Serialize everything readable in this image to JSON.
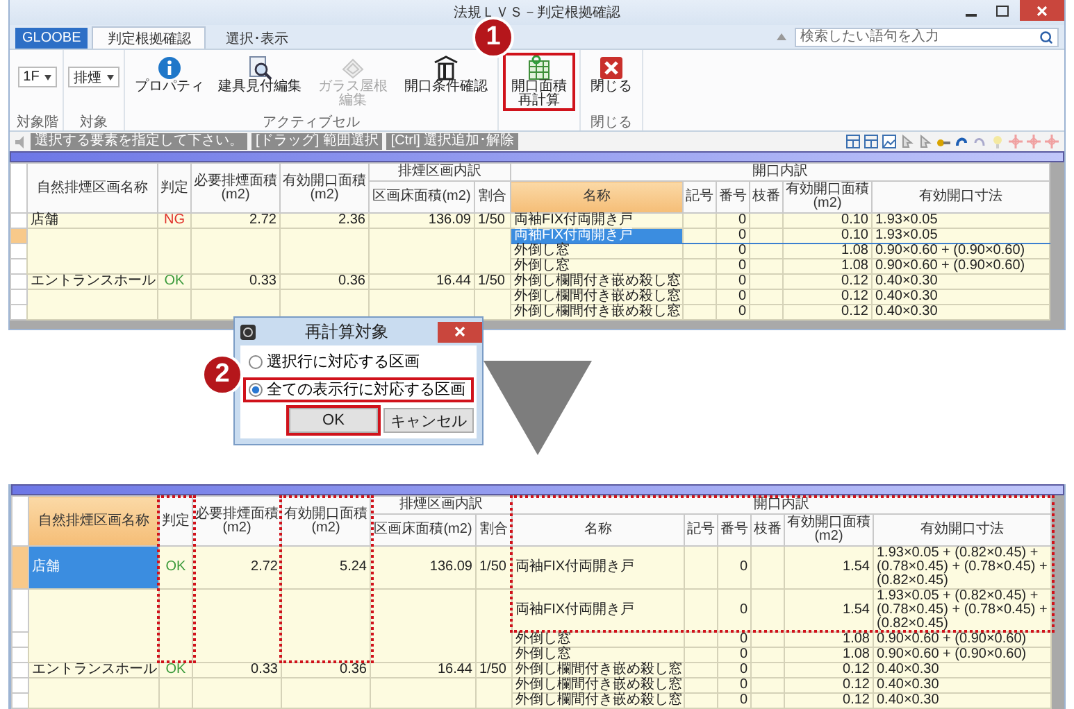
{
  "window": {
    "title": "法規ＬＶＳ－判定根拠確認"
  },
  "tabs": [
    {
      "label": "GLOOBE",
      "kind": "app",
      "selected": false
    },
    {
      "label": "判定根拠確認",
      "kind": "tab",
      "selected": true
    },
    {
      "label": "選択･表示",
      "kind": "tab",
      "selected": false
    }
  ],
  "search": {
    "placeholder": "検索したい語句を入力"
  },
  "ribbon": [
    {
      "label": "対象階",
      "items": [
        {
          "kind": "dropdown",
          "value": "1F"
        }
      ]
    },
    {
      "label": "対象",
      "items": [
        {
          "kind": "dropdown",
          "value": "排煙"
        }
      ]
    },
    {
      "label": "アクティブセル",
      "items": [
        {
          "kind": "button",
          "label": "プロパティ",
          "disabled": false,
          "highlighted": false
        },
        {
          "kind": "button",
          "label": "建具見付編集",
          "disabled": false,
          "highlighted": false
        },
        {
          "kind": "button",
          "label": "ガラス屋根編集",
          "disabled": true,
          "highlighted": false
        },
        {
          "kind": "button",
          "label": "開口条件確認",
          "disabled": false,
          "highlighted": false
        }
      ]
    },
    {
      "items": [
        {
          "kind": "button",
          "label": "開口面積再計算",
          "disabled": false,
          "highlighted": true,
          "callout": "1"
        }
      ]
    },
    {
      "label": "閉じる",
      "items": [
        {
          "kind": "button",
          "label": "閉じる",
          "disabled": false,
          "highlighted": false
        }
      ]
    }
  ],
  "hints": [
    "選択する要素を指定して下さい。",
    "[ドラッグ] 範囲選択",
    "[Ctrl] 選択追加･解除"
  ],
  "top_table": {
    "groups": [
      {
        "label": "排煙区画内訳"
      },
      {
        "label": "開口内訳"
      }
    ],
    "columns": [
      {
        "label": "自然排煙区画名称",
        "selected": false
      },
      {
        "label": "判定",
        "selected": false
      },
      {
        "label": "必要排煙面積(m2)",
        "selected": false
      },
      {
        "label": "有効開口面積(m2)",
        "selected": false
      },
      {
        "label": "区画床面積(m2)",
        "selected": false
      },
      {
        "label": "割合",
        "selected": false
      },
      {
        "label": "名称",
        "selected": true
      },
      {
        "label": "記号",
        "selected": false
      },
      {
        "label": "番号",
        "selected": false
      },
      {
        "label": "枝番",
        "selected": false
      },
      {
        "label": "有効開口面積(m2)",
        "selected": false
      },
      {
        "label": "有効開口寸法",
        "selected": false
      }
    ],
    "zones": [
      {
        "name": "店舗",
        "verdict": "NG",
        "pass": false,
        "required_area": "2.72",
        "effective_area": "2.36",
        "floor_area": "136.09",
        "ratio": "1/50",
        "selected": false,
        "openings": [
          {
            "name": "両袖FIX付両開き戸",
            "number": "0",
            "area": "0.10",
            "dimension": "1.93×0.05",
            "selected": false
          },
          {
            "name": "両袖FIX付両開き戸",
            "number": "0",
            "area": "0.10",
            "dimension": "1.93×0.05",
            "selected": true
          },
          {
            "name": "外倒し窓",
            "number": "0",
            "area": "1.08",
            "dimension": "0.90×0.60 + (0.90×0.60)",
            "selected": false
          },
          {
            "name": "外倒し窓",
            "number": "0",
            "area": "1.08",
            "dimension": "0.90×0.60 + (0.90×0.60)",
            "selected": false
          }
        ]
      },
      {
        "name": "エントランスホール",
        "verdict": "OK",
        "pass": true,
        "required_area": "0.33",
        "effective_area": "0.36",
        "floor_area": "16.44",
        "ratio": "1/50",
        "selected": false,
        "openings": [
          {
            "name": "外倒し欄間付き嵌め殺し窓",
            "number": "0",
            "area": "0.12",
            "dimension": "0.40×0.30",
            "selected": false
          },
          {
            "name": "外倒し欄間付き嵌め殺し窓",
            "number": "0",
            "area": "0.12",
            "dimension": "0.40×0.30",
            "selected": false
          },
          {
            "name": "外倒し欄間付き嵌め殺し窓",
            "number": "0",
            "area": "0.12",
            "dimension": "0.40×0.30",
            "selected": false
          }
        ]
      }
    ]
  },
  "dialog": {
    "title": "再計算対象",
    "callout": "2",
    "options": [
      {
        "label": "選択行に対応する区画",
        "selected": false,
        "highlighted": false
      },
      {
        "label": "全ての表示行に対応する区画",
        "selected": true,
        "highlighted": true
      }
    ],
    "buttons": [
      {
        "label": "OK",
        "highlighted": true
      },
      {
        "label": "キャンセル",
        "highlighted": false
      }
    ]
  },
  "bottom_table": {
    "groups": [
      {
        "label": "排煙区画内訳",
        "highlighted": false
      },
      {
        "label": "開口内訳",
        "highlighted": true
      }
    ],
    "columns": [
      {
        "label": "自然排煙区画名称",
        "selected": true,
        "highlighted": false
      },
      {
        "label": "判定",
        "selected": false,
        "highlighted": true
      },
      {
        "label": "必要排煙面積(m2)",
        "selected": false,
        "highlighted": false
      },
      {
        "label": "有効開口面積(m2)",
        "selected": false,
        "highlighted": true
      },
      {
        "label": "区画床面積(m2)",
        "selected": false,
        "highlighted": false
      },
      {
        "label": "割合",
        "selected": false,
        "highlighted": false
      },
      {
        "label": "名称",
        "selected": false,
        "highlighted": false
      },
      {
        "label": "記号",
        "selected": false,
        "highlighted": false
      },
      {
        "label": "番号",
        "selected": false,
        "highlighted": false
      },
      {
        "label": "枝番",
        "selected": false,
        "highlighted": false
      },
      {
        "label": "有効開口面積(m2)",
        "selected": false,
        "highlighted": false
      },
      {
        "label": "有効開口寸法",
        "selected": false,
        "highlighted": false
      }
    ],
    "zones": [
      {
        "name": "店舗",
        "verdict": "OK",
        "pass": true,
        "required_area": "2.72",
        "effective_area": "5.24",
        "floor_area": "136.09",
        "ratio": "1/50",
        "selected": true,
        "highlighted": true,
        "openings": [
          {
            "name": "両袖FIX付両開き戸",
            "number": "0",
            "area": "1.54",
            "dimension": "1.93×0.05 + (0.82×0.45) + (0.78×0.45) + (0.78×0.45) + (0.82×0.45)",
            "selected": false,
            "highlighted": true
          },
          {
            "name": "両袖FIX付両開き戸",
            "number": "0",
            "area": "1.54",
            "dimension": "1.93×0.05 + (0.82×0.45) + (0.78×0.45) + (0.78×0.45) + (0.82×0.45)",
            "selected": false,
            "highlighted": true
          },
          {
            "name": "外倒し窓",
            "number": "0",
            "area": "1.08",
            "dimension": "0.90×0.60 + (0.90×0.60)",
            "selected": false,
            "highlighted": false
          },
          {
            "name": "外倒し窓",
            "number": "0",
            "area": "1.08",
            "dimension": "0.90×0.60 + (0.90×0.60)",
            "selected": false,
            "highlighted": false
          }
        ]
      },
      {
        "name": "エントランスホール",
        "verdict": "OK",
        "pass": true,
        "required_area": "0.33",
        "effective_area": "0.36",
        "floor_area": "16.44",
        "ratio": "1/50",
        "selected": false,
        "highlighted": false,
        "openings": [
          {
            "name": "外倒し欄間付き嵌め殺し窓",
            "number": "0",
            "area": "0.12",
            "dimension": "0.40×0.30",
            "selected": false,
            "highlighted": false
          },
          {
            "name": "外倒し欄間付き嵌め殺し窓",
            "number": "0",
            "area": "0.12",
            "dimension": "0.40×0.30",
            "selected": false,
            "highlighted": false
          },
          {
            "name": "外倒し欄間付き嵌め殺し窓",
            "number": "0",
            "area": "0.12",
            "dimension": "0.40×0.30",
            "selected": false,
            "highlighted": false
          }
        ]
      }
    ]
  }
}
